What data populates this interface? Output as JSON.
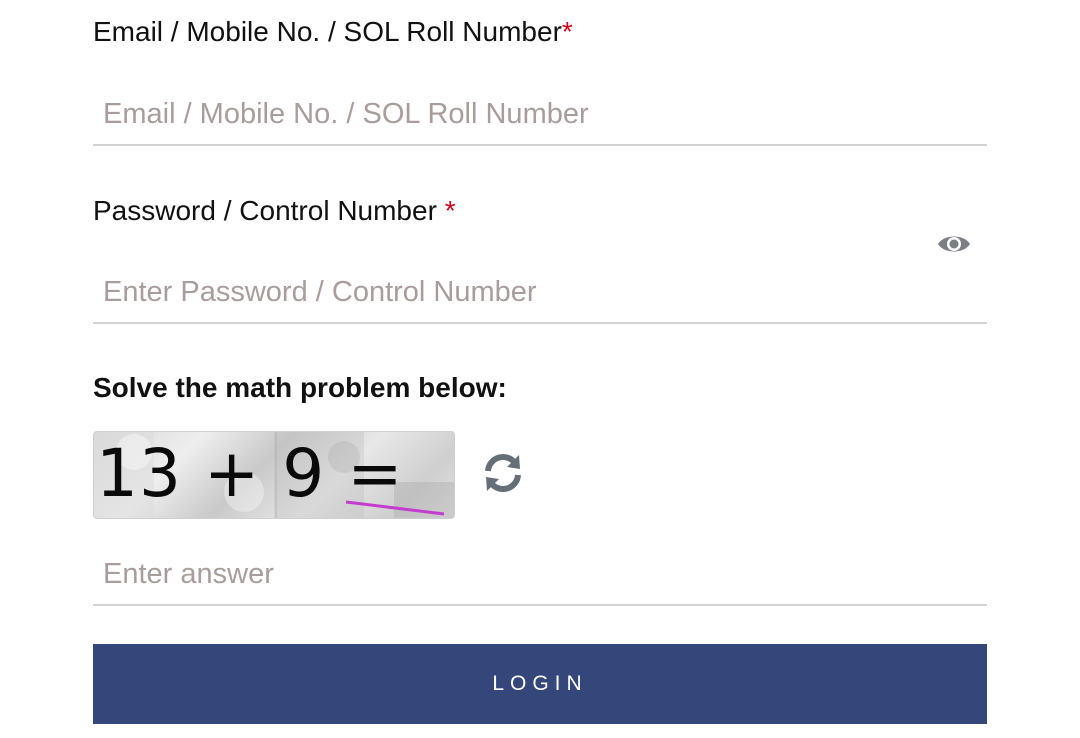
{
  "email": {
    "label": "Email / Mobile No. / SOL Roll Number",
    "required_mark": "*",
    "placeholder": "Email / Mobile No. / SOL Roll Number"
  },
  "password": {
    "label": "Password / Control Number ",
    "required_mark": "*",
    "placeholder": "Enter Password / Control Number",
    "toggle_icon": "eye-icon"
  },
  "captcha": {
    "prompt": "Solve the math problem below:",
    "expression": "13 + 9 =",
    "refresh_icon": "refresh-icon",
    "answer_placeholder": "Enter answer"
  },
  "login": {
    "label": "LOGIN"
  },
  "colors": {
    "required": "#d0021b",
    "button_bg": "#35477a",
    "placeholder": "#a89d9b",
    "icon": "#666f78"
  }
}
